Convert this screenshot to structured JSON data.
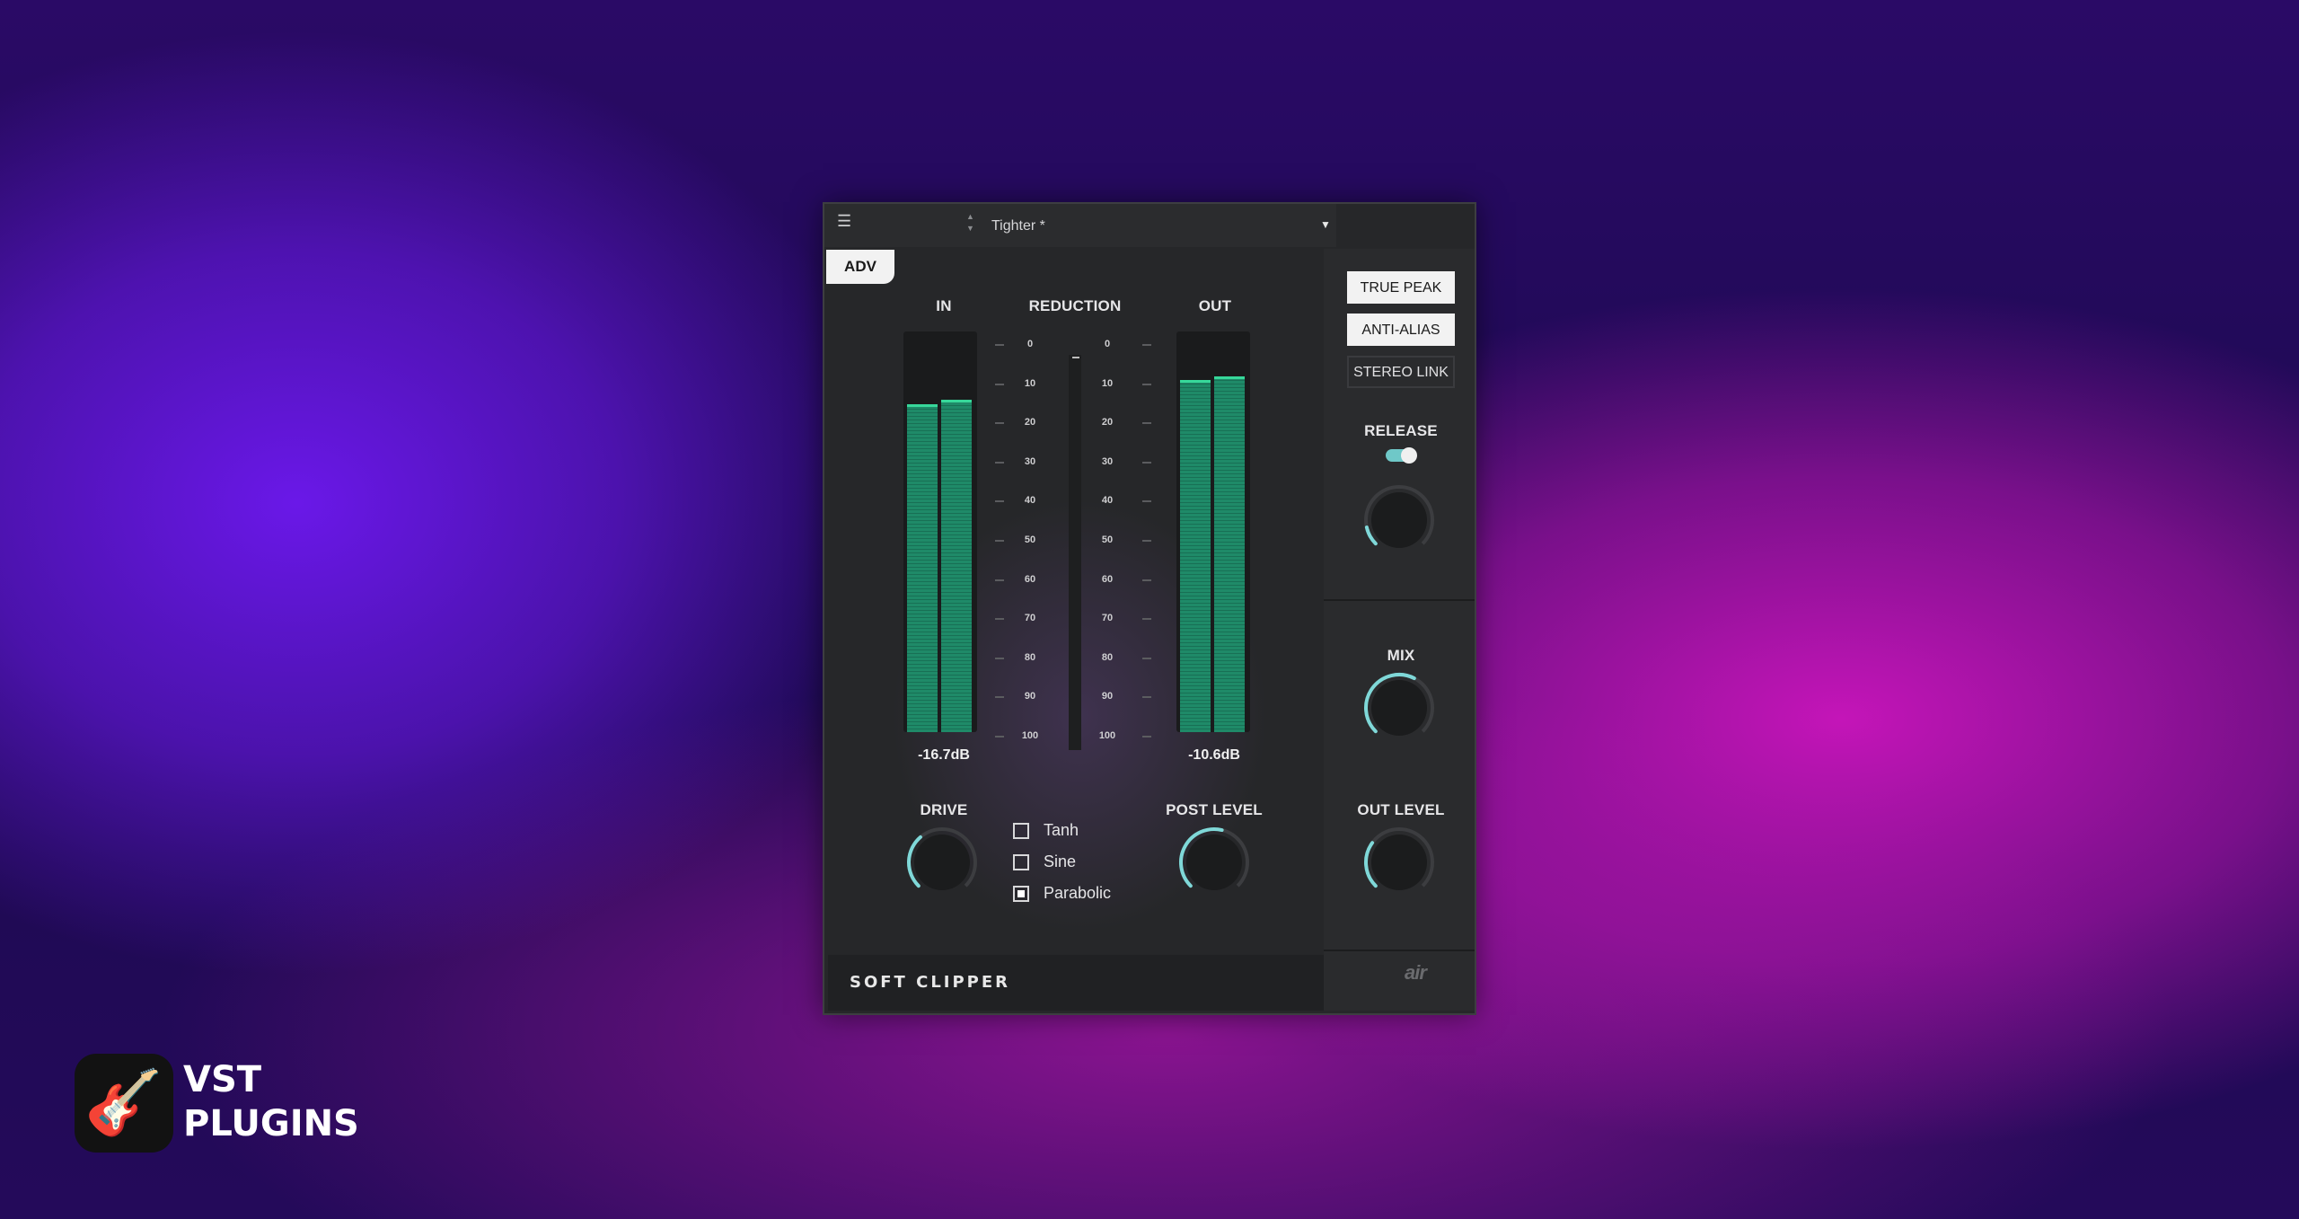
{
  "topbar": {
    "menu_icon": "hamburger-menu-icon",
    "preset_name": "Tighter *",
    "up_arrow": "▲",
    "down_arrow": "▼",
    "dropdown_arrow": "▼"
  },
  "mode_button": "ADV",
  "meters": {
    "in_label": "IN",
    "reduction_label": "REDUCTION",
    "out_label": "OUT",
    "scale": [
      "0",
      "10",
      "20",
      "30",
      "40",
      "50",
      "60",
      "70",
      "80",
      "90",
      "100"
    ],
    "in_value": "-16.7dB",
    "out_value": "-10.6dB",
    "in_levels": [
      0.83,
      0.84
    ],
    "out_levels": [
      0.89,
      0.9
    ],
    "reduction_level": 0.0
  },
  "knobs": {
    "drive_label": "DRIVE",
    "drive_value": 0.35,
    "post_level_label": "POST LEVEL",
    "post_level_value": 0.55,
    "release_label": "RELEASE",
    "release_value": 0.12,
    "mix_label": "MIX",
    "mix_value": 0.6,
    "out_level_label": "OUT LEVEL",
    "out_level_value": 0.3
  },
  "curves": [
    {
      "label": "Tanh",
      "checked": false
    },
    {
      "label": "Sine",
      "checked": false
    },
    {
      "label": "Parabolic",
      "checked": true
    }
  ],
  "side_buttons": {
    "true_peak": "TRUE PEAK",
    "true_peak_on": true,
    "anti_alias": "ANTI-ALIAS",
    "anti_alias_on": true,
    "stereo_link": "STEREO LINK",
    "stereo_link_on": false
  },
  "release_toggle_on": true,
  "footer": {
    "plugin_name": "SOFT CLIPPER",
    "maker_logo": "air"
  },
  "watermark": {
    "logo_icon": "guitar-icon",
    "line1": "VST",
    "line2": "PLUGINS"
  },
  "colors": {
    "meter_green": "#1f8a68",
    "meter_peak": "#37d89a",
    "knob_arc": "#7fd8d8",
    "panel": "#262729"
  }
}
